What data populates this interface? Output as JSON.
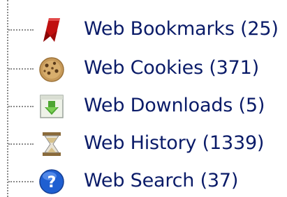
{
  "tree": {
    "items": [
      {
        "label": "Web Bookmarks (25)",
        "icon": "bookmark-icon"
      },
      {
        "label": "Web Cookies (371)",
        "icon": "cookie-icon"
      },
      {
        "label": "Web Downloads (5)",
        "icon": "download-icon"
      },
      {
        "label": "Web History (1339)",
        "icon": "hourglass-icon"
      },
      {
        "label": "Web Search (37)",
        "icon": "help-search-icon"
      }
    ]
  },
  "colors": {
    "label_text": "#0a1b68",
    "tree_line": "#8a8a8a"
  }
}
